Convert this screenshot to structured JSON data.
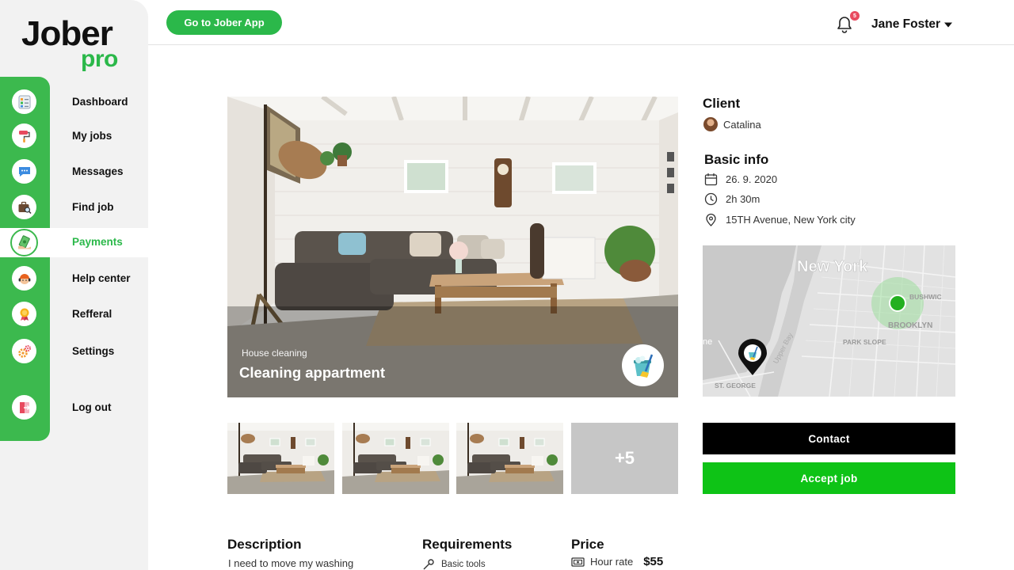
{
  "brand": {
    "name": "Jober",
    "suffix": "pro"
  },
  "header": {
    "go_button": "Go to Jober App",
    "notification_count": "5",
    "user_name": "Jane Foster"
  },
  "sidebar": {
    "items": [
      {
        "label": "Dashboard",
        "icon": "checklist-icon"
      },
      {
        "label": "My jobs",
        "icon": "paint-roller-icon"
      },
      {
        "label": "Messages",
        "icon": "chat-bubble-icon"
      },
      {
        "label": "Find job",
        "icon": "briefcase-search-icon"
      },
      {
        "label": "Payments",
        "icon": "money-hand-icon",
        "active": true
      },
      {
        "label": "Help center",
        "icon": "support-agent-icon"
      },
      {
        "label": "Refferal",
        "icon": "medal-icon"
      },
      {
        "label": "Settings",
        "icon": "gears-icon"
      },
      {
        "label": "Log out",
        "icon": "logout-door-icon"
      }
    ]
  },
  "job": {
    "category": "House cleaning",
    "title": "Cleaning appartment",
    "category_icon": "cleaning-bucket-icon",
    "more_photos": "+5"
  },
  "client": {
    "heading": "Client",
    "name": "Catalina"
  },
  "basic_info": {
    "heading": "Basic info",
    "date": "26. 9. 2020",
    "duration": "2h 30m",
    "address": "15TH Avenue, New York city"
  },
  "map": {
    "labels": {
      "city": "New York",
      "bushwick": "BUSHWIC",
      "brooklyn": "BROOKLYN",
      "park_slope": "PARK SLOPE",
      "st_george": "ST. GEORGE",
      "upper_bay": "Upper Bay",
      "edge": "ne"
    }
  },
  "actions": {
    "contact": "Contact",
    "accept": "Accept job"
  },
  "details": {
    "description_heading": "Description",
    "description_text": "I need to move my washing",
    "requirements_heading": "Requirements",
    "requirement_1": "Basic tools",
    "price_heading": "Price",
    "price_label": "Hour rate",
    "price_value": "$55"
  },
  "colors": {
    "brand_green": "#3cb94e",
    "accept_green": "#0ec316",
    "badge_red": "#e84a5f"
  }
}
